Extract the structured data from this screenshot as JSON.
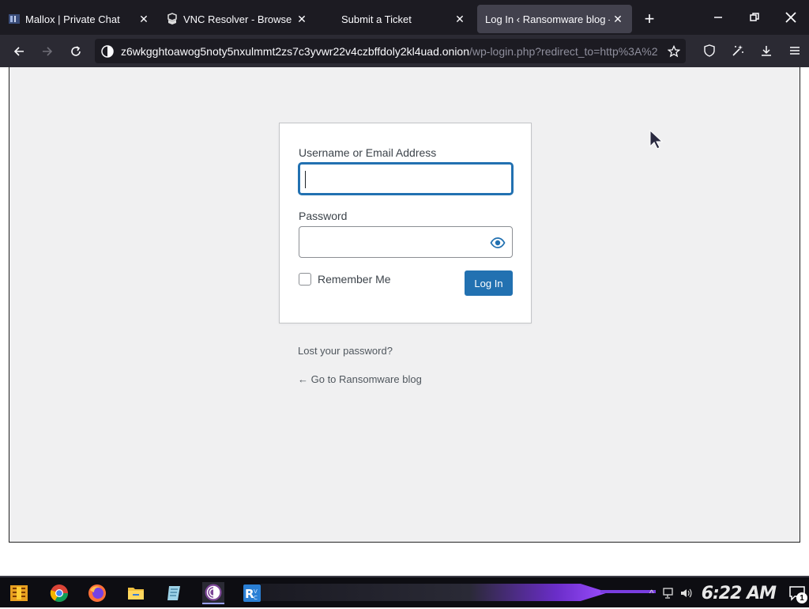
{
  "browser": {
    "tabs": [
      {
        "title": "Mallox | Private Chat",
        "icon": "mallox-favicon",
        "active": false
      },
      {
        "title": "VNC Resolver - Browse",
        "icon": "vnc-favicon",
        "active": false
      },
      {
        "title": "Submit a Ticket",
        "icon": "",
        "active": false
      },
      {
        "title": "Log In ‹ Ransomware blog —",
        "icon": "",
        "active": true
      }
    ],
    "url_host": "z6wkgghtoawog5noty5nxulmmt2zs7c3yvwr22v4czbffdoly2kl4uad.onion",
    "url_path": "/wp-login.php?redirect_to=http%3A%2"
  },
  "login": {
    "username_label": "Username or Email Address",
    "username_value": "",
    "password_label": "Password",
    "password_value": "",
    "remember_label": "Remember Me",
    "login_button": "Log In",
    "lost_password": "Lost your password?",
    "back_link": "← Go to Ransomware blog"
  },
  "taskbar": {
    "clock": "6:22 AM",
    "notification_count": "1",
    "apps": [
      "start-icon",
      "chrome-icon",
      "firefox-icon",
      "file-explorer-icon",
      "notepad-icon",
      "tor-browser-icon",
      "remote-desktop-icon"
    ]
  },
  "colors": {
    "accent": "#2271b1",
    "page_bg": "#f0f0f1",
    "browser_dark": "#1c1b22"
  }
}
